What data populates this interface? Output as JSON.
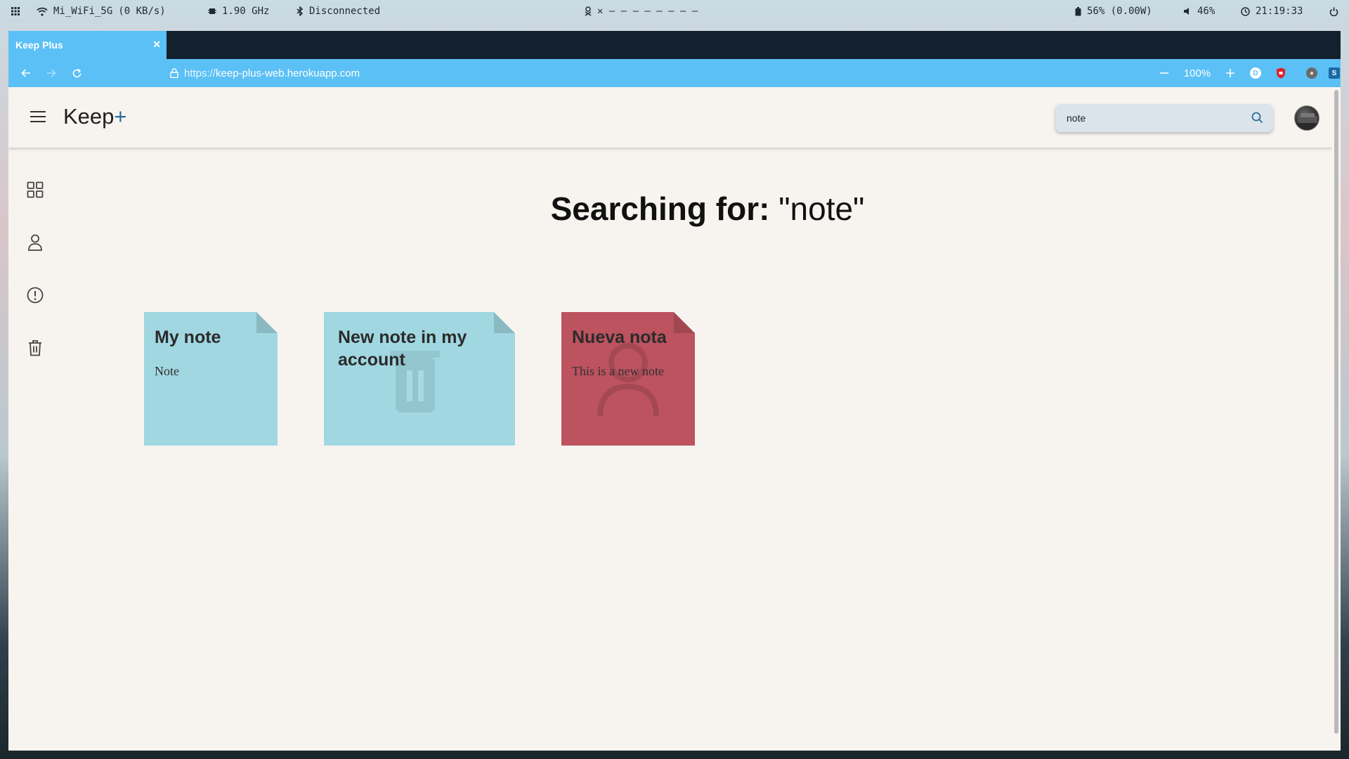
{
  "system_bar": {
    "wifi_label": "Mi_WiFi_5G",
    "net_speed": "(0 KB/s)",
    "cpu": "1.90 GHz",
    "bluetooth": "Disconnected",
    "workspaces": "✕ – – – – – – – –",
    "battery": "56% (0.00W)",
    "volume": "46%",
    "clock": "21:19:33"
  },
  "browser": {
    "tab_title": "Keep Plus",
    "url_scheme": "https://",
    "url_host": "keep-plus-web.herokuapp.com",
    "zoom": "100%"
  },
  "app": {
    "logo": "Keep",
    "logo_plus": "+",
    "search": {
      "value": "note",
      "placeholder": ""
    },
    "heading_lead": "Searching for:",
    "heading_query": "\"note\""
  },
  "nav_items": [
    {
      "name": "notes",
      "icon": "grid-icon"
    },
    {
      "name": "profile",
      "icon": "user-icon"
    },
    {
      "name": "about",
      "icon": "alert-circle-icon"
    },
    {
      "name": "trash",
      "icon": "trash-icon"
    }
  ],
  "notes": [
    {
      "title": "My note",
      "body": "Note",
      "color": "#a1d7e1"
    },
    {
      "title": "New note in my account",
      "body": "",
      "color": "#a1d7e1"
    },
    {
      "title": "Nueva nota",
      "body": "This is a new note",
      "color": "#bc535f"
    }
  ],
  "colors": {
    "accent": "#5bc0f5",
    "tabstrip": "#13202e",
    "app_bg": "#f7f4f0",
    "logo_plus": "#2b6c99"
  }
}
